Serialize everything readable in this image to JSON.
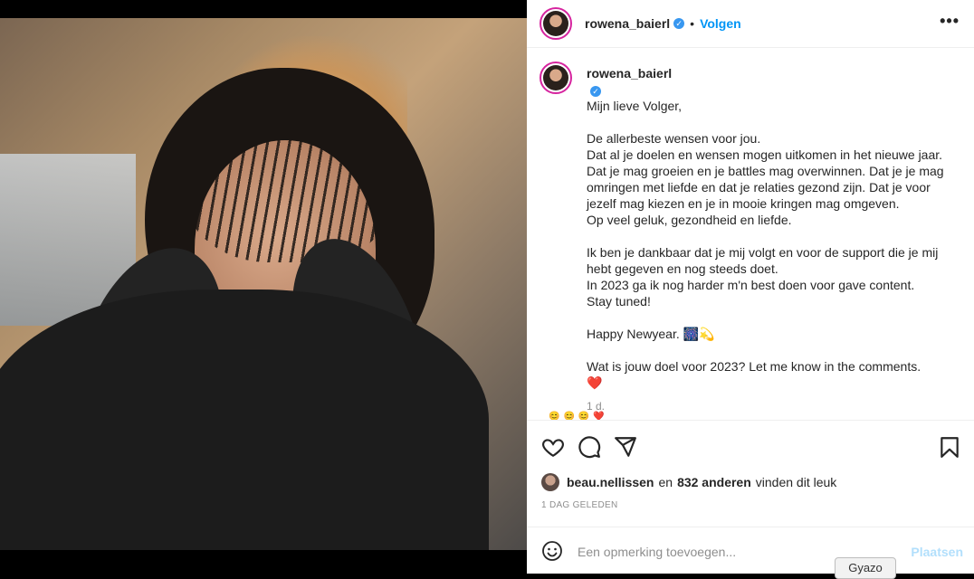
{
  "post": {
    "username": "rowena_baierl",
    "verified_mark": "✓",
    "dot": "•",
    "follow_label": "Volgen",
    "more_label": "•••",
    "caption_lines": [
      "Mijn lieve Volger,",
      "",
      "De allerbeste wensen voor jou.",
      "Dat al je doelen en wensen mogen uitkomen in het nieuwe jaar. Dat je mag groeien en je battles mag overwinnen. Dat je je mag omringen met liefde en dat je relaties gezond zijn. Dat je voor jezelf mag kiezen en je in mooie kringen mag omgeven.",
      "Op veel geluk, gezondheid en liefde.",
      "",
      "Ik ben je dankbaar dat je mij volgt en voor de support die je mij hebt gegeven en nog steeds doet.",
      "In 2023 ga ik nog harder m'n best doen voor gave content.",
      "Stay tuned!",
      "",
      "Happy Newyear. 🎆💫",
      "",
      "Wat is jouw doel voor 2023? Let me know in the comments.",
      "❤️"
    ],
    "caption_time": "1 d.",
    "comment_peek": "😊😊😊❤️"
  },
  "likes": {
    "liker": "beau.nellissen",
    "joiner": "en",
    "count": "832 anderen",
    "suffix": "vinden dit leuk"
  },
  "time_ago": "1 DAG GELEDEN",
  "comment_box": {
    "placeholder": "Een opmerking toevoegen...",
    "post_label": "Plaatsen"
  },
  "gyazo_label": "Gyazo",
  "icons": [
    "heart-icon",
    "comment-icon",
    "share-icon",
    "bookmark-icon",
    "emoji-icon",
    "more-icon",
    "verified-icon"
  ]
}
